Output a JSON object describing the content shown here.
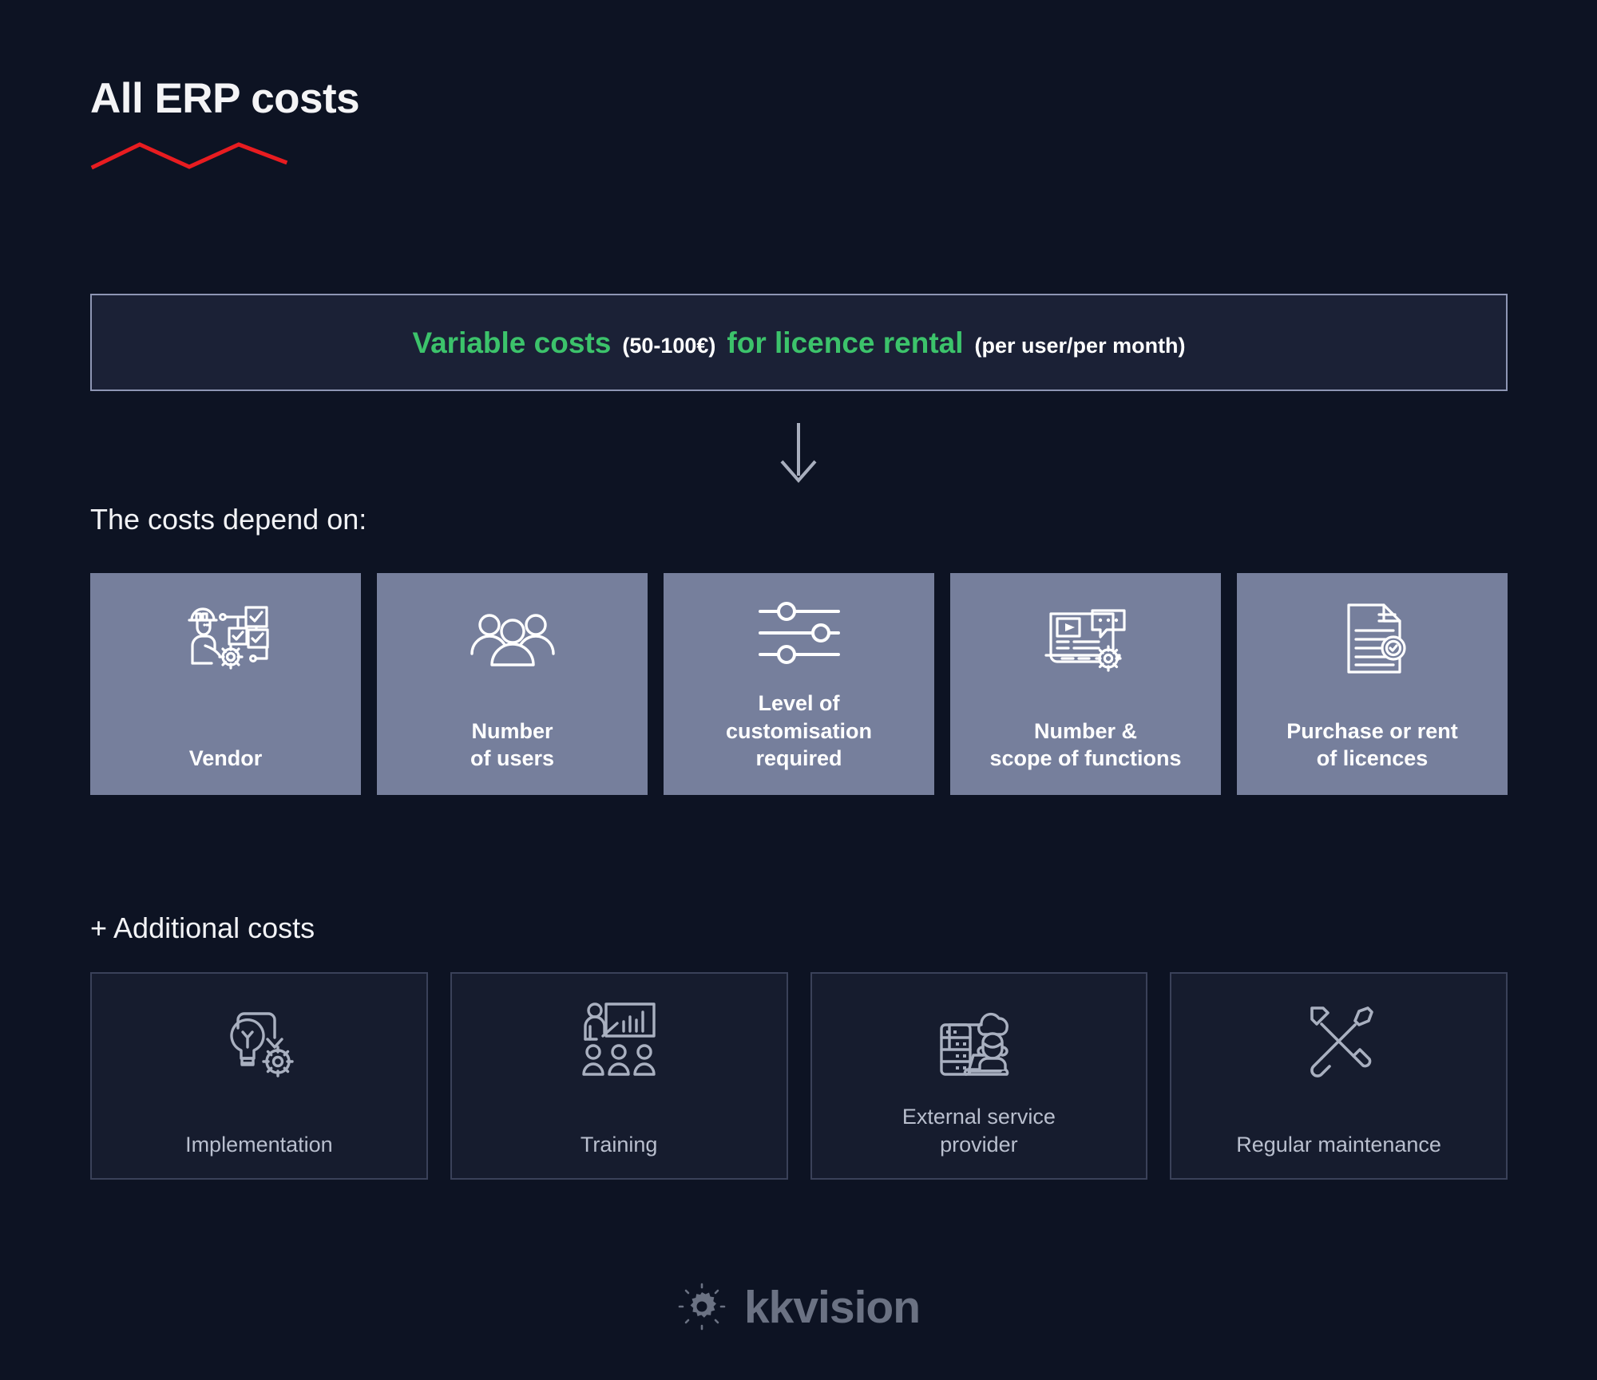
{
  "header": {
    "title": "All ERP costs",
    "accent_color": "#e81c20"
  },
  "banner": {
    "part1": "Variable costs",
    "part2": "(50-100€)",
    "part3": "for licence rental",
    "part4": "(per user/per month)",
    "accent_color": "#3cc36b",
    "border_color": "#8e96b4"
  },
  "arrow": {
    "name": "down-arrow"
  },
  "sections": {
    "depends_label": "The costs depend on:",
    "additional_label": "+ Additional costs"
  },
  "cards": [
    {
      "label": "Vendor",
      "icon": "engineer-workflow-icon"
    },
    {
      "label": "Number\nof users",
      "icon": "users-group-icon"
    },
    {
      "label": "Level of\ncustomisation\nrequired",
      "icon": "sliders-icon"
    },
    {
      "label": "Number &\nscope of functions",
      "icon": "media-settings-icon"
    },
    {
      "label": "Purchase or rent\nof licences",
      "icon": "certified-document-icon"
    }
  ],
  "additional_cards": [
    {
      "label": "Implementation",
      "icon": "lightbulb-gear-icon"
    },
    {
      "label": "Training",
      "icon": "presentation-training-icon"
    },
    {
      "label": "External service\nprovider",
      "icon": "server-cloud-support-icon"
    },
    {
      "label": "Regular maintenance",
      "icon": "wrench-screwdriver-icon"
    }
  ],
  "footer": {
    "logo_text": "kkvision",
    "logo_color": "#6b7283"
  },
  "theme": {
    "background": "#0d1323",
    "card_background": "#767f9c",
    "add_card_background": "#161c2e",
    "add_card_border": "#3a4159"
  }
}
